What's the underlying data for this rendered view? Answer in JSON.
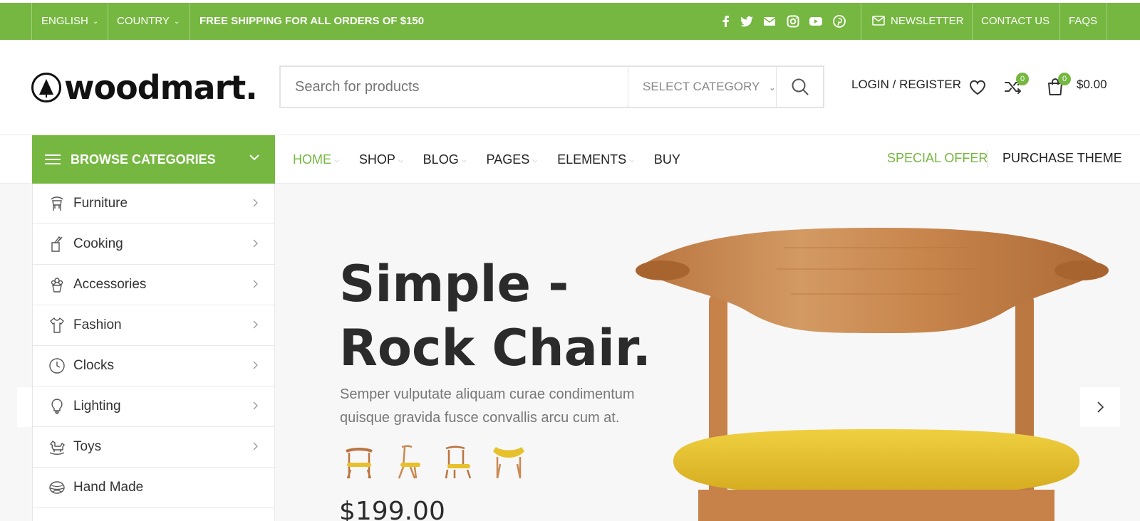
{
  "topbar": {
    "language": "ENGLISH",
    "country": "COUNTRY",
    "promo": "FREE SHIPPING FOR ALL ORDERS OF $150",
    "social_icons": [
      "facebook-icon",
      "twitter-icon",
      "email-icon",
      "instagram-icon",
      "youtube-icon",
      "pinterest-icon"
    ],
    "newsletter": "NEWSLETTER",
    "contact": "CONTACT US",
    "faqs": "FAQS"
  },
  "header": {
    "logo_text": "woodmart.",
    "search_placeholder": "Search for products",
    "select_category": "SELECT CATEGORY",
    "login": "LOGIN / REGISTER",
    "compare_count": "0",
    "cart_count": "0",
    "cart_total": "$0.00"
  },
  "nav": {
    "browse": "BROWSE CATEGORIES",
    "menu": [
      {
        "label": "HOME",
        "dropdown": true
      },
      {
        "label": "SHOP",
        "dropdown": true
      },
      {
        "label": "BLOG",
        "dropdown": true
      },
      {
        "label": "PAGES",
        "dropdown": true
      },
      {
        "label": "ELEMENTS",
        "dropdown": true
      },
      {
        "label": "BUY",
        "dropdown": false
      }
    ],
    "special_offer": "SPECIAL OFFER",
    "purchase_theme": "PURCHASE THEME"
  },
  "categories": [
    {
      "label": "Furniture",
      "icon": "chair-icon",
      "has_sub": true
    },
    {
      "label": "Cooking",
      "icon": "kitchen-knife-icon",
      "has_sub": true
    },
    {
      "label": "Accessories",
      "icon": "plant-pot-icon",
      "has_sub": true
    },
    {
      "label": "Fashion",
      "icon": "shirt-icon",
      "has_sub": true
    },
    {
      "label": "Clocks",
      "icon": "clock-icon",
      "has_sub": true
    },
    {
      "label": "Lighting",
      "icon": "light-bulb-icon",
      "has_sub": true
    },
    {
      "label": "Toys",
      "icon": "rocking-horse-icon",
      "has_sub": true
    },
    {
      "label": "Hand Made",
      "icon": "yarn-icon",
      "has_sub": false
    }
  ],
  "hero": {
    "title_line1": "Simple -",
    "title_line2": "Rock Chair.",
    "description": "Semper vulputate aliquam curae condimentum quisque gravida fusce convallis arcu cum at.",
    "price": "$199.00"
  },
  "colors": {
    "accent": "#75b740",
    "hero_bg": "#f7f7f7",
    "chair_wood": "#c98a52",
    "chair_seat": "#e6c12c"
  }
}
